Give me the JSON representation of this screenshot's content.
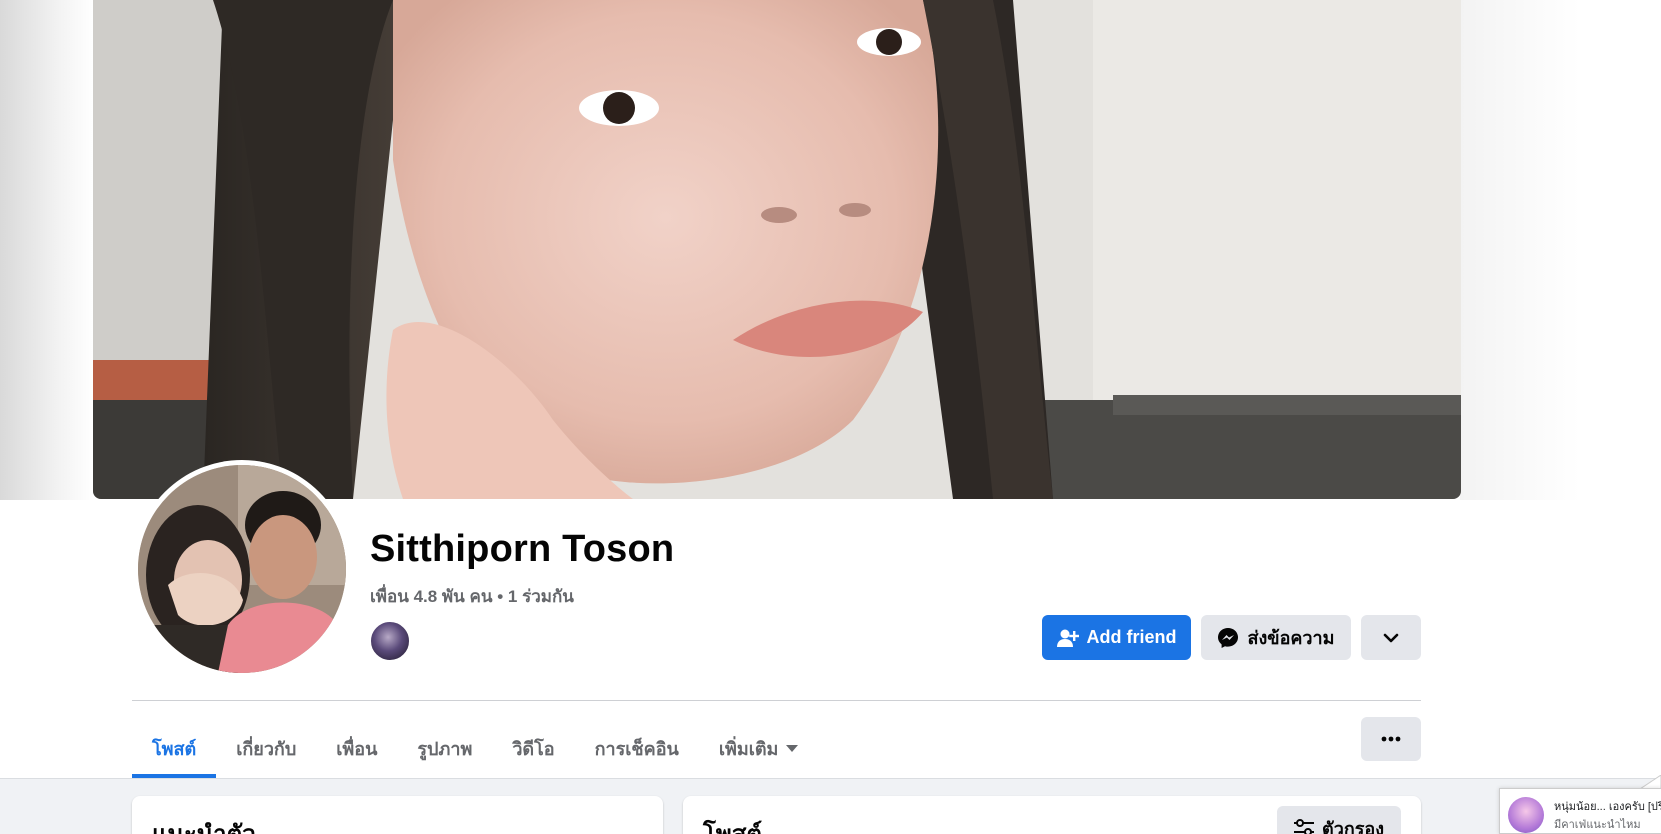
{
  "profile": {
    "name": "Sitthiporn Toson",
    "friends_text": "เพื่อน 4.8 พัน คน",
    "separator": "•",
    "mutual_text": "1 ร่วมกัน"
  },
  "actions": {
    "add_friend_label": "Add friend",
    "message_label": "ส่งข้อความ",
    "more_icon": "chevron-down-icon"
  },
  "tabs": [
    {
      "label": "โพสต์",
      "active": true
    },
    {
      "label": "เกี่ยวกับ",
      "active": false
    },
    {
      "label": "เพื่อน",
      "active": false
    },
    {
      "label": "รูปภาพ",
      "active": false
    },
    {
      "label": "วิดีโอ",
      "active": false
    },
    {
      "label": "การเช็คอิน",
      "active": false
    },
    {
      "label": "เพิ่มเติม",
      "active": false
    }
  ],
  "tab_more_icon": "ellipsis-icon",
  "sections": {
    "intro_title": "แนะนำตัว",
    "posts_title": "โพสต์",
    "filter_label": "ตัวกรอง"
  },
  "notification": {
    "line1": "หนุ่มน้อย... เองครับ [ปรึกษา]",
    "line2": "มีคาเฟ่แนะนำไหม"
  },
  "colors": {
    "primary": "#1b74e4",
    "secondary_bg": "#e4e6eb",
    "muted_text": "#65676b",
    "page_bg": "#f0f2f5"
  }
}
